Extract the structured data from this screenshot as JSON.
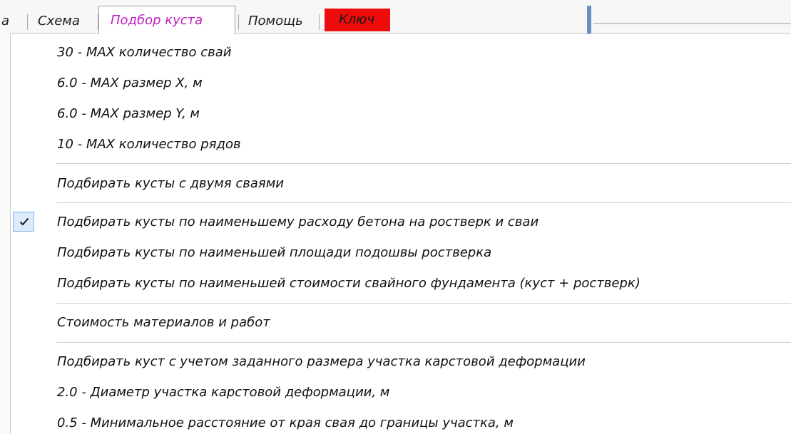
{
  "menubar": {
    "edge_label": "а",
    "schema_label": "Схема",
    "select_label": "Подбор куста",
    "help_label": "Помощь",
    "key_label": "Ключ"
  },
  "dropdown": {
    "items": [
      {
        "label": "30 - MAX количество свай"
      },
      {
        "label": "6.0 - MAX размер X, м"
      },
      {
        "label": "6.0 - MAX размер Y, м"
      },
      {
        "label": "10 - MAX количество рядов"
      },
      {
        "label": "Подбирать кусты с двумя сваями"
      },
      {
        "label": "Подбирать кусты по наименьшему расходу бетона на ростверк и сваи",
        "checked": true
      },
      {
        "label": "Подбирать кусты по наименьшей площади подошвы ростверка"
      },
      {
        "label": "Подбирать кусты по наименьшей стоимости свайного фундамента (куст + ростверк)"
      },
      {
        "label": "Стоимость материалов и работ"
      },
      {
        "label": "Подбирать куст с учетом заданного размера участка карстовой деформации"
      },
      {
        "label": "2.0 - Диаметр участка карстовой деформации, м"
      },
      {
        "label": "0.5 - Минимальное расстояние от края свая до границы участка, м"
      }
    ]
  },
  "colors": {
    "selected_menu_text": "#c21fbf",
    "key_background": "#ee0b0b",
    "check_background": "#dcebfb",
    "check_border": "#7eb4ea"
  },
  "icons": {
    "checkmark": "check-icon"
  }
}
